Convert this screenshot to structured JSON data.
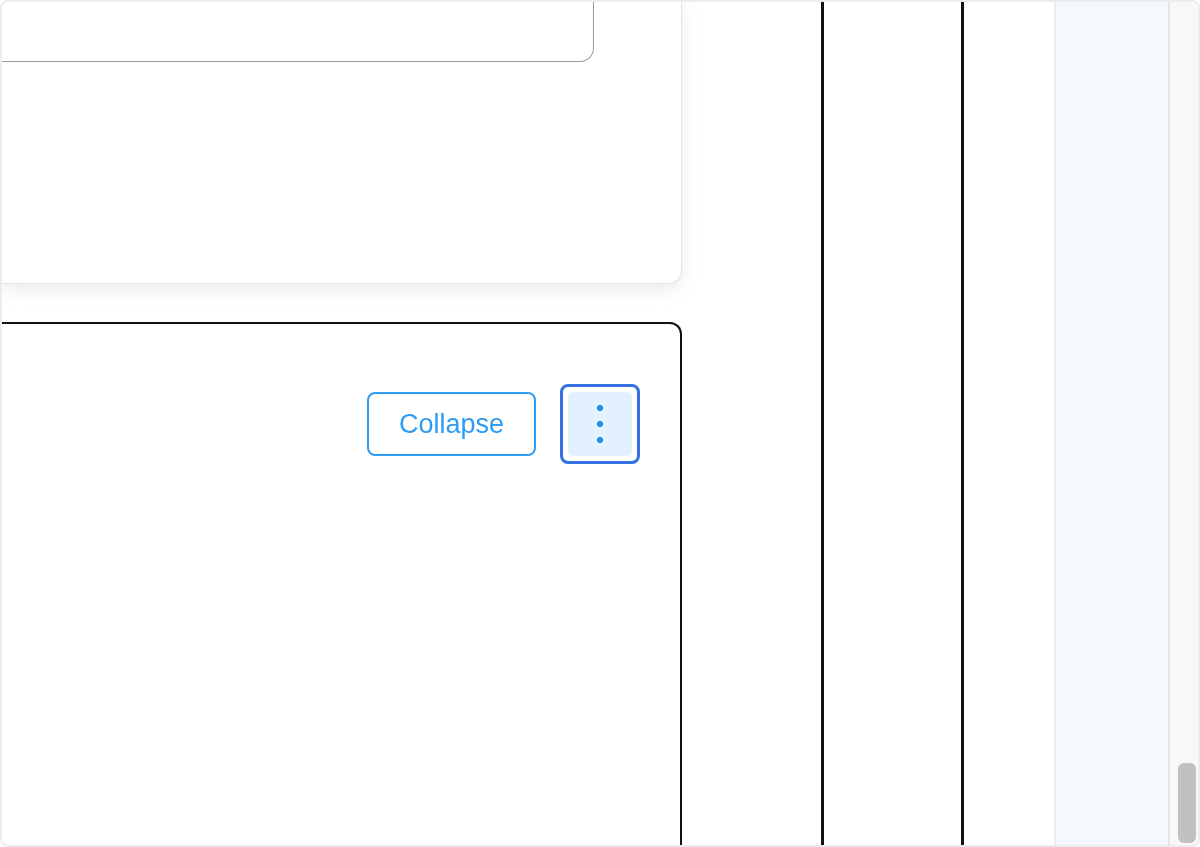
{
  "panel": {
    "collapse_button": {
      "label": "Collapse"
    },
    "more_button": {
      "focused": true
    }
  }
}
